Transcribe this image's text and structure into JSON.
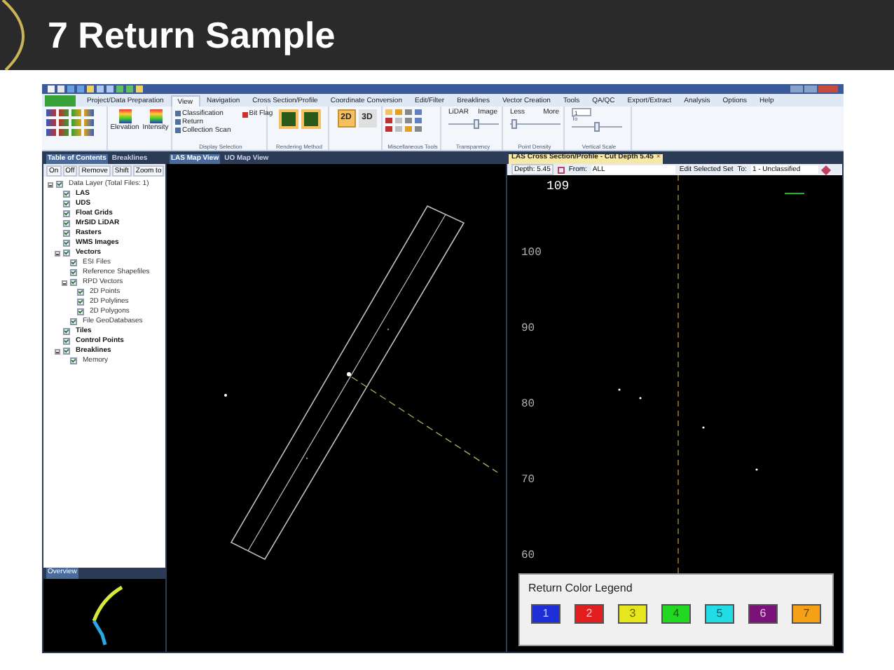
{
  "slide_title": "7 Return Sample",
  "menu_tabs": [
    {
      "label": "Project/Data Preparation",
      "selected": false
    },
    {
      "label": "View",
      "selected": true
    },
    {
      "label": "Navigation",
      "selected": false
    },
    {
      "label": "Cross Section/Profile",
      "selected": false
    },
    {
      "label": "Coordinate Conversion",
      "selected": false
    },
    {
      "label": "Edit/Filter",
      "selected": false
    },
    {
      "label": "Breaklines",
      "selected": false
    },
    {
      "label": "Vector Creation",
      "selected": false
    },
    {
      "label": "Tools",
      "selected": false
    },
    {
      "label": "QA/QC",
      "selected": false
    },
    {
      "label": "Export/Extract",
      "selected": false
    },
    {
      "label": "Analysis",
      "selected": false
    },
    {
      "label": "Options",
      "selected": false
    },
    {
      "label": "Help",
      "selected": false
    }
  ],
  "ribbon": {
    "big_buttons": [
      "Elevation",
      "Intensity"
    ],
    "display_selection": {
      "items": [
        "Classification",
        "Return",
        "Collection Scan"
      ],
      "bit_flag": "Bit Flag",
      "label": "Display Selection"
    },
    "rendering_method": {
      "label": "Rendering Method"
    },
    "dimension": [
      {
        "label": "2D",
        "selected": true
      },
      {
        "label": "3D",
        "selected": false
      }
    ],
    "misc_label": "Miscellaneous Tools",
    "sliders": [
      {
        "left": "LiDAR",
        "right": "Image",
        "level": 0.55,
        "label": "Transparency"
      },
      {
        "left": "Less",
        "right": "More",
        "level": 0.03,
        "label": "Point Density"
      }
    ],
    "vertical_scale": {
      "value": "1",
      "to": "To",
      "level": 0.5,
      "label": "Vertical Scale"
    }
  },
  "toc": {
    "tabs": [
      {
        "label": "Table of Contents",
        "selected": true
      },
      {
        "label": "Breaklines",
        "selected": false
      }
    ],
    "buttons": [
      "On",
      "Off",
      "Remove",
      "Shift",
      "Zoom to"
    ],
    "tree": [
      {
        "label": "Data Layer (Total Files: 1)",
        "checked": true,
        "expanded": true,
        "children": [
          {
            "label": "LAS",
            "checked": true
          },
          {
            "label": "UDS",
            "checked": true
          },
          {
            "label": "Float Grids",
            "checked": true
          },
          {
            "label": "MrSID LiDAR",
            "checked": true
          },
          {
            "label": "Rasters",
            "checked": true
          },
          {
            "label": "WMS Images",
            "checked": true
          },
          {
            "label": "Vectors",
            "checked": true,
            "expanded": true,
            "children": [
              {
                "label": "ESI Files",
                "checked": true
              },
              {
                "label": "Reference Shapefiles",
                "checked": true
              },
              {
                "label": "RPD Vectors",
                "checked": true,
                "expanded": true,
                "children": [
                  {
                    "label": "2D Points",
                    "checked": true
                  },
                  {
                    "label": "2D Polylines",
                    "checked": true
                  },
                  {
                    "label": "2D Polygons",
                    "checked": true
                  }
                ]
              },
              {
                "label": "File GeoDatabases",
                "checked": true
              }
            ]
          },
          {
            "label": "Tiles",
            "checked": true
          },
          {
            "label": "Control Points",
            "checked": true
          },
          {
            "label": "Breaklines",
            "checked": true,
            "expanded": true,
            "children": [
              {
                "label": "Memory",
                "checked": true
              }
            ]
          }
        ]
      }
    ]
  },
  "overview": {
    "title": "Overview"
  },
  "map_tabs": [
    {
      "label": "LAS Map View",
      "selected": true
    },
    {
      "label": "UO Map View",
      "selected": false
    }
  ],
  "profile": {
    "tab": "LAS Cross Section/Profile - Cut Depth 5.45",
    "close": "×",
    "depth": "Depth: 5.45",
    "from_label": "From:",
    "from_value": "ALL",
    "edit": "Edit Selected Set",
    "to_label": "To:",
    "to_value": "1 - Unclassified",
    "axis_labels": [
      "109",
      "100",
      "90",
      "80",
      "70",
      "60"
    ]
  },
  "legend": {
    "title": "Return Color Legend",
    "items": [
      {
        "label": "1",
        "color": "#1f2fd8"
      },
      {
        "label": "2",
        "color": "#e31e1e"
      },
      {
        "label": "3",
        "color": "#e6e61e"
      },
      {
        "label": "4",
        "color": "#22d822"
      },
      {
        "label": "5",
        "color": "#22dde6"
      },
      {
        "label": "6",
        "color": "#7a127a"
      },
      {
        "label": "7",
        "color": "#f5a017"
      }
    ]
  }
}
